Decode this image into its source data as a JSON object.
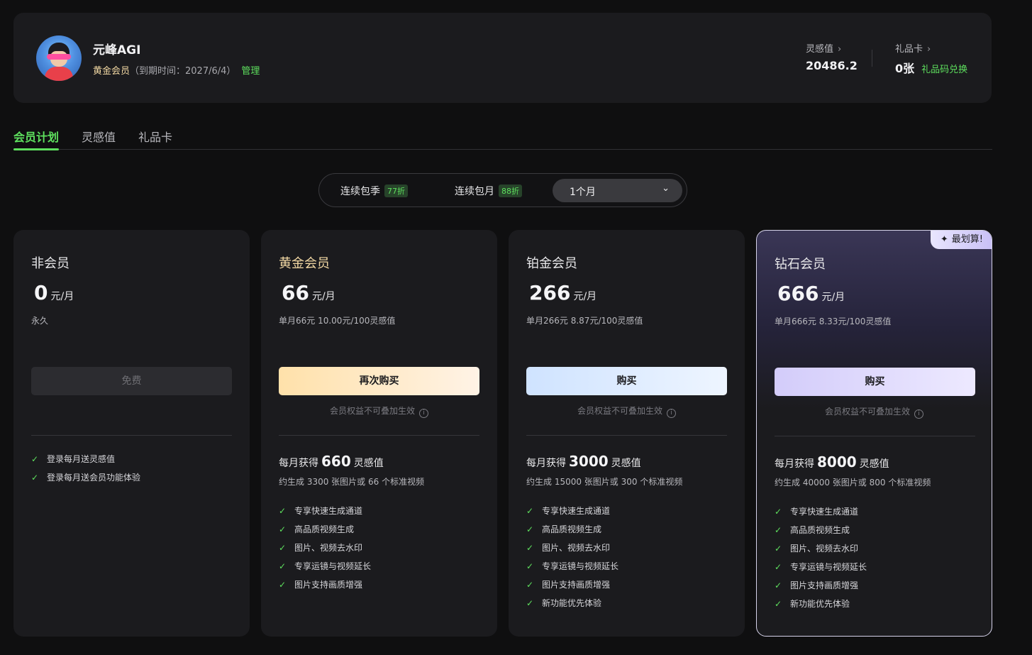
{
  "user": {
    "name": "元峰AGI",
    "level": "黄金会员",
    "expiry": "（到期时间：2027/6/4）",
    "manage_label": "管理"
  },
  "stats": {
    "inspiration_label": "灵感值",
    "inspiration_value": "20486.2",
    "giftcard_label": "礼品卡",
    "giftcard_value": "0张",
    "redeem_label": "礼品码兑换",
    "chevron": "›"
  },
  "tabs": [
    "会员计划",
    "灵感值",
    "礼品卡"
  ],
  "period": {
    "options": [
      {
        "label": "连续包季",
        "badge": "77折"
      },
      {
        "label": "连续包月",
        "badge": "88折"
      }
    ],
    "selected": "1个月",
    "chevron": "⌄"
  },
  "colors": {
    "accent": "#5ee05e",
    "gold": "#f3d9a4",
    "background": "#0f0f10",
    "card": "#1b1b1e"
  },
  "icons": {
    "check": "✓",
    "info": "i",
    "sparkle": "✦"
  },
  "plans": [
    {
      "name": "非会员",
      "price": "0",
      "unit": "元/月",
      "desc": "永久",
      "button": "免费",
      "features": [
        "登录每月送灵感值",
        "登录每月送会员功能体验"
      ]
    },
    {
      "name": "黄金会员",
      "price": "66",
      "unit": "元/月",
      "desc": "单月66元 10.00元/100灵感值",
      "button": "再次购买",
      "note": "会员权益不可叠加生效",
      "credits_prefix": "每月获得",
      "credits": "660",
      "credits_suffix": "灵感值",
      "credits_desc": "约生成 3300 张图片或 66 个标准视频",
      "features": [
        "专享快速生成通道",
        "高品质视频生成",
        "图片、视频去水印",
        "专享运镜与视频延长",
        "图片支持画质增强"
      ]
    },
    {
      "name": "铂金会员",
      "price": "266",
      "unit": "元/月",
      "desc": "单月266元 8.87元/100灵感值",
      "button": "购买",
      "note": "会员权益不可叠加生效",
      "credits_prefix": "每月获得",
      "credits": "3000",
      "credits_suffix": "灵感值",
      "credits_desc": "约生成 15000 张图片或 300 个标准视频",
      "features": [
        "专享快速生成通道",
        "高品质视频生成",
        "图片、视频去水印",
        "专享运镜与视频延长",
        "图片支持画质增强",
        "新功能优先体验"
      ]
    },
    {
      "name": "钻石会员",
      "badge": "最划算!",
      "price": "666",
      "unit": "元/月",
      "desc": "单月666元 8.33元/100灵感值",
      "button": "购买",
      "note": "会员权益不可叠加生效",
      "credits_prefix": "每月获得",
      "credits": "8000",
      "credits_suffix": "灵感值",
      "credits_desc": "约生成 40000 张图片或 800 个标准视频",
      "features": [
        "专享快速生成通道",
        "高品质视频生成",
        "图片、视频去水印",
        "专享运镜与视频延长",
        "图片支持画质增强",
        "新功能优先体验"
      ]
    }
  ]
}
